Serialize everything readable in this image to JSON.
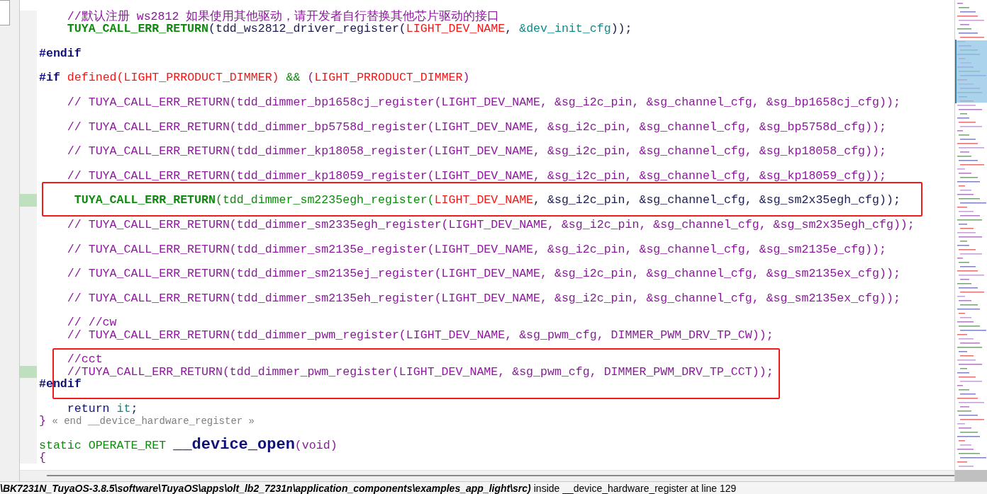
{
  "editor": {
    "lines": [
      {
        "kind": "code",
        "changed": false,
        "tokens": [
          {
            "kind": "comment",
            "text": "    //默认注册 ws2812 如果使用其他驱动，请开发者自行替换其他芯片驱动的接口"
          }
        ]
      },
      {
        "kind": "code",
        "changed": false,
        "tokens": [
          {
            "kind": "macro",
            "text": "    TUYA_CALL_ERR_RETURN"
          },
          {
            "kind": "plain",
            "text": "(tdd_ws2812_driver_register("
          },
          {
            "kind": "name",
            "text": "LIGHT_DEV_NAME"
          },
          {
            "kind": "plain",
            "text": ", "
          },
          {
            "kind": "var",
            "text": "&dev_init_cfg"
          },
          {
            "kind": "plain",
            "text": "));"
          }
        ]
      },
      {
        "kind": "blank"
      },
      {
        "kind": "code",
        "changed": false,
        "tokens": [
          {
            "kind": "preproc",
            "text": "#endif"
          }
        ]
      },
      {
        "kind": "blank"
      },
      {
        "kind": "code",
        "changed": false,
        "tokens": [
          {
            "kind": "preproc",
            "text": "#if "
          },
          {
            "kind": "name",
            "text": "defined(LIGHT_PRRODUCT_DIMMER) "
          },
          {
            "kind": "op",
            "text": "&& "
          },
          {
            "kind": "comment",
            "text": "("
          },
          {
            "kind": "name",
            "text": "LIGHT_PRRODUCT_DIMMER"
          },
          {
            "kind": "comment",
            "text": ")"
          }
        ]
      },
      {
        "kind": "blank"
      },
      {
        "kind": "code",
        "changed": false,
        "tokens": [
          {
            "kind": "comment",
            "text": "    // TUYA_CALL_ERR_RETURN(tdd_dimmer_bp1658cj_register(LIGHT_DEV_NAME, &sg_i2c_pin, &sg_channel_cfg, &sg_bp1658cj_cfg));"
          }
        ]
      },
      {
        "kind": "blank"
      },
      {
        "kind": "code",
        "changed": false,
        "tokens": [
          {
            "kind": "comment",
            "text": "    // TUYA_CALL_ERR_RETURN(tdd_dimmer_bp5758d_register(LIGHT_DEV_NAME, &sg_i2c_pin, &sg_channel_cfg, &sg_bp5758d_cfg));"
          }
        ]
      },
      {
        "kind": "blank"
      },
      {
        "kind": "code",
        "changed": false,
        "tokens": [
          {
            "kind": "comment",
            "text": "    // TUYA_CALL_ERR_RETURN(tdd_dimmer_kp18058_register(LIGHT_DEV_NAME, &sg_i2c_pin, &sg_channel_cfg, &sg_kp18058_cfg));"
          }
        ]
      },
      {
        "kind": "blank"
      },
      {
        "kind": "code",
        "changed": false,
        "tokens": [
          {
            "kind": "comment",
            "text": "    // TUYA_CALL_ERR_RETURN(tdd_dimmer_kp18059_register(LIGHT_DEV_NAME, &sg_i2c_pin, &sg_channel_cfg, &sg_kp18059_cfg));"
          }
        ]
      },
      {
        "kind": "blank"
      },
      {
        "kind": "code",
        "changed": true,
        "tokens": [
          {
            "kind": "macro",
            "text": "     TUYA_CALL_ERR_RETURN"
          },
          {
            "kind": "func",
            "text": "(tdd_dimmer_sm2235egh_register("
          },
          {
            "kind": "name",
            "text": "LIGHT_DEV_NAME"
          },
          {
            "kind": "plain",
            "text": ", &sg_i2c_pin, &sg_channel_cfg, &sg_sm2x35egh_cfg));"
          }
        ]
      },
      {
        "kind": "blank"
      },
      {
        "kind": "code",
        "changed": false,
        "tokens": [
          {
            "kind": "comment",
            "text": "    // TUYA_CALL_ERR_RETURN(tdd_dimmer_sm2335egh_register(LIGHT_DEV_NAME, &sg_i2c_pin, &sg_channel_cfg, &sg_sm2x35egh_cfg));"
          }
        ]
      },
      {
        "kind": "blank"
      },
      {
        "kind": "code",
        "changed": false,
        "tokens": [
          {
            "kind": "comment",
            "text": "    // TUYA_CALL_ERR_RETURN(tdd_dimmer_sm2135e_register(LIGHT_DEV_NAME, &sg_i2c_pin, &sg_channel_cfg, &sg_sm2135e_cfg));"
          }
        ]
      },
      {
        "kind": "blank"
      },
      {
        "kind": "code",
        "changed": false,
        "tokens": [
          {
            "kind": "comment",
            "text": "    // TUYA_CALL_ERR_RETURN(tdd_dimmer_sm2135ej_register(LIGHT_DEV_NAME, &sg_i2c_pin, &sg_channel_cfg, &sg_sm2135ex_cfg));"
          }
        ]
      },
      {
        "kind": "blank"
      },
      {
        "kind": "code",
        "changed": false,
        "tokens": [
          {
            "kind": "comment",
            "text": "    // TUYA_CALL_ERR_RETURN(tdd_dimmer_sm2135eh_register(LIGHT_DEV_NAME, &sg_i2c_pin, &sg_channel_cfg, &sg_sm2135ex_cfg));"
          }
        ]
      },
      {
        "kind": "blank"
      },
      {
        "kind": "code",
        "changed": false,
        "tokens": [
          {
            "kind": "comment",
            "text": "    // //cw"
          }
        ]
      },
      {
        "kind": "code",
        "changed": false,
        "tokens": [
          {
            "kind": "comment",
            "text": "    // TUYA_CALL_ERR_RETURN(tdd_dimmer_pwm_register(LIGHT_DEV_NAME, &sg_pwm_cfg, DIMMER_PWM_DRV_TP_CW));"
          }
        ]
      },
      {
        "kind": "blank"
      },
      {
        "kind": "code",
        "changed": false,
        "tokens": [
          {
            "kind": "comment",
            "text": "    //cct"
          }
        ]
      },
      {
        "kind": "code",
        "changed": true,
        "tokens": [
          {
            "kind": "comment",
            "text": "    //TUYA_CALL_ERR_RETURN(tdd_dimmer_pwm_register(LIGHT_DEV_NAME, &sg_pwm_cfg, DIMMER_PWM_DRV_TP_CCT));"
          }
        ]
      },
      {
        "kind": "code",
        "changed": false,
        "tokens": [
          {
            "kind": "preproc",
            "text": "#endif"
          }
        ]
      },
      {
        "kind": "blank"
      },
      {
        "kind": "code",
        "changed": false,
        "tokens": [
          {
            "kind": "keyword",
            "text": "    return "
          },
          {
            "kind": "var",
            "text": "it"
          },
          {
            "kind": "plain",
            "text": ";"
          }
        ]
      },
      {
        "kind": "code",
        "changed": false,
        "tokens": [
          {
            "kind": "comment",
            "text": "}"
          },
          {
            "kind": "note",
            "text": " « end __device_hardware_register »"
          }
        ]
      },
      {
        "kind": "blank"
      },
      {
        "kind": "code",
        "changed": false,
        "tokens": [
          {
            "kind": "type",
            "text": "static OPERATE_RET "
          },
          {
            "kind": "def",
            "text": "__device_open"
          },
          {
            "kind": "comment",
            "text": "(void)"
          }
        ]
      },
      {
        "kind": "code",
        "changed": false,
        "tokens": [
          {
            "kind": "comment",
            "text": "{"
          }
        ]
      }
    ]
  },
  "status_bar": {
    "path": "\\BK7231N_TuyaOS-3.8.5\\software\\TuyaOS\\apps\\olt_lb2_7231n\\application_components\\examples_app_light\\src)",
    "context": "inside __device_hardware_register at line 129"
  }
}
